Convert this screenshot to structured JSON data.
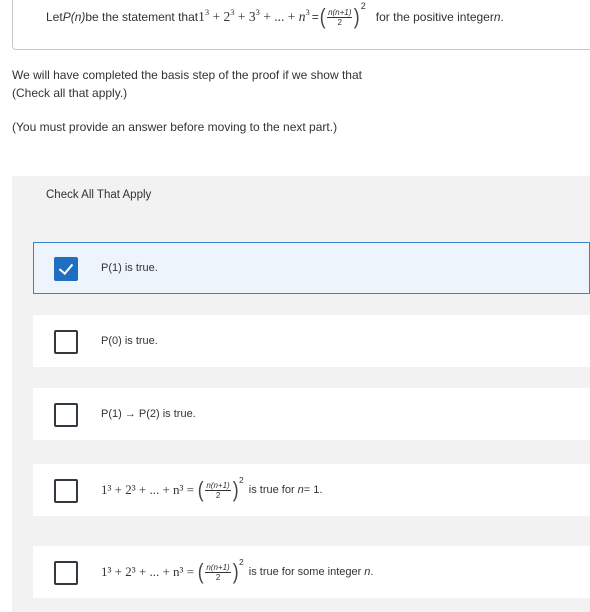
{
  "question": {
    "intro": "Let ",
    "p_of_n": "P(n)",
    "be": " be the statement that ",
    "sum": "1",
    "plus_terms": [
      "2",
      "3"
    ],
    "ellipsis": " + ... + ",
    "n_var": "n",
    "cube": "3",
    "equals": " = ",
    "frac_num": "n(n+1)",
    "frac_den": "2",
    "square": "2",
    "tail": "for the positive integer ",
    "tail_var": "n",
    "tail_end": "."
  },
  "instructions": {
    "line1": "We will have completed the basis step of the proof if we show that",
    "line2": "(Check all that apply.)",
    "line3": "(You must provide an answer before moving to the next part.)"
  },
  "panel": {
    "heading": "Check All That Apply"
  },
  "choices": [
    {
      "label": "P(1) is true.",
      "checked": true
    },
    {
      "label": "P(0) is true.",
      "checked": false
    },
    {
      "label": "P(1) → P(2) is true.",
      "checked": false
    },
    {
      "expr_lhs": "1³ + 2³ + ... + n³ =",
      "frac_num": "n(n+1)",
      "frac_den": "2",
      "square": "2",
      "suffix": "is true for ",
      "suffix_var": "n",
      "suffix_end": " = 1.",
      "checked": false
    },
    {
      "expr_lhs": "1³ + 2³ + ... + n³ =",
      "frac_num": "n(n+1)",
      "frac_den": "2",
      "square": "2",
      "suffix": "is true for some integer ",
      "suffix_var": "n",
      "suffix_end": ".",
      "checked": false
    }
  ],
  "colors": {
    "accent": "#1e6fc2",
    "panel_bg": "#f2f2f2",
    "selected_bg": "#edf4fc"
  }
}
